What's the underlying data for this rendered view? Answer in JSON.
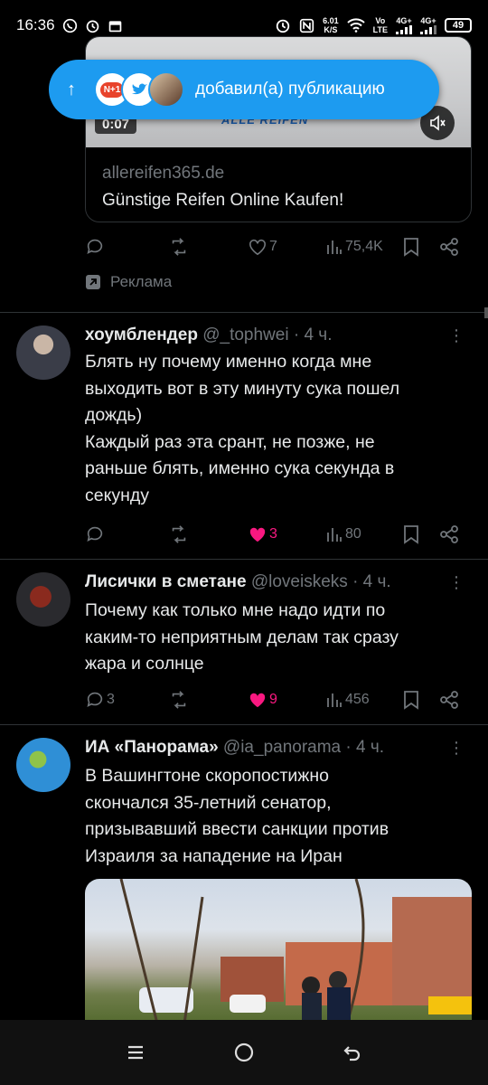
{
  "status_bar": {
    "time": "16:36",
    "net_speed_value": "6.01",
    "net_speed_unit": "K/S",
    "vo_lte_top": "Vo",
    "vo_lte_bottom": "LTE",
    "signal1": "4G+",
    "signal2": "4G+",
    "battery": "49"
  },
  "ad": {
    "video_time": "0:07",
    "brand_text": "ALLE REIFEN",
    "domain": "allereifen365.de",
    "title": "Günstige Reifen Online Kaufen!",
    "likes": "7",
    "views": "75,4K",
    "promoted_label": "Реклама"
  },
  "new_posts_pill": {
    "badge": "N+1",
    "text": "добавил(а) публикацию"
  },
  "tweets": [
    {
      "name": "хоумблендер",
      "handle": "@_tophwei",
      "time": "· 4 ч.",
      "text": "Блять ну почему именно когда мне\nвыходить вот в эту минуту сука пошел\nдождь)\nКаждый раз эта срант, не позже, не\nраньше блять, именно сука секунда в\nсекунду",
      "replies": "",
      "likes": "3",
      "views": "80"
    },
    {
      "name": "Лисички в сметане",
      "handle": "@loveiskeks",
      "time": "· 4 ч.",
      "text": "Почему как только мне надо идти по\nкаким-то неприятным делам так сразу\nжара и солнце",
      "replies": "3",
      "likes": "9",
      "views": "456"
    },
    {
      "name": "ИА «Панорама»",
      "handle": "@ia_panorama",
      "time": "· 4 ч.",
      "text": "В Вашингтоне скоропостижно\nскончался 35-летний сенатор,\nпризывавший ввести санкции против\nИзраиля за нападение на Иран"
    }
  ],
  "colors": {
    "accent": "#1d9bf0",
    "like_active": "#f91880",
    "muted": "#71767b"
  }
}
